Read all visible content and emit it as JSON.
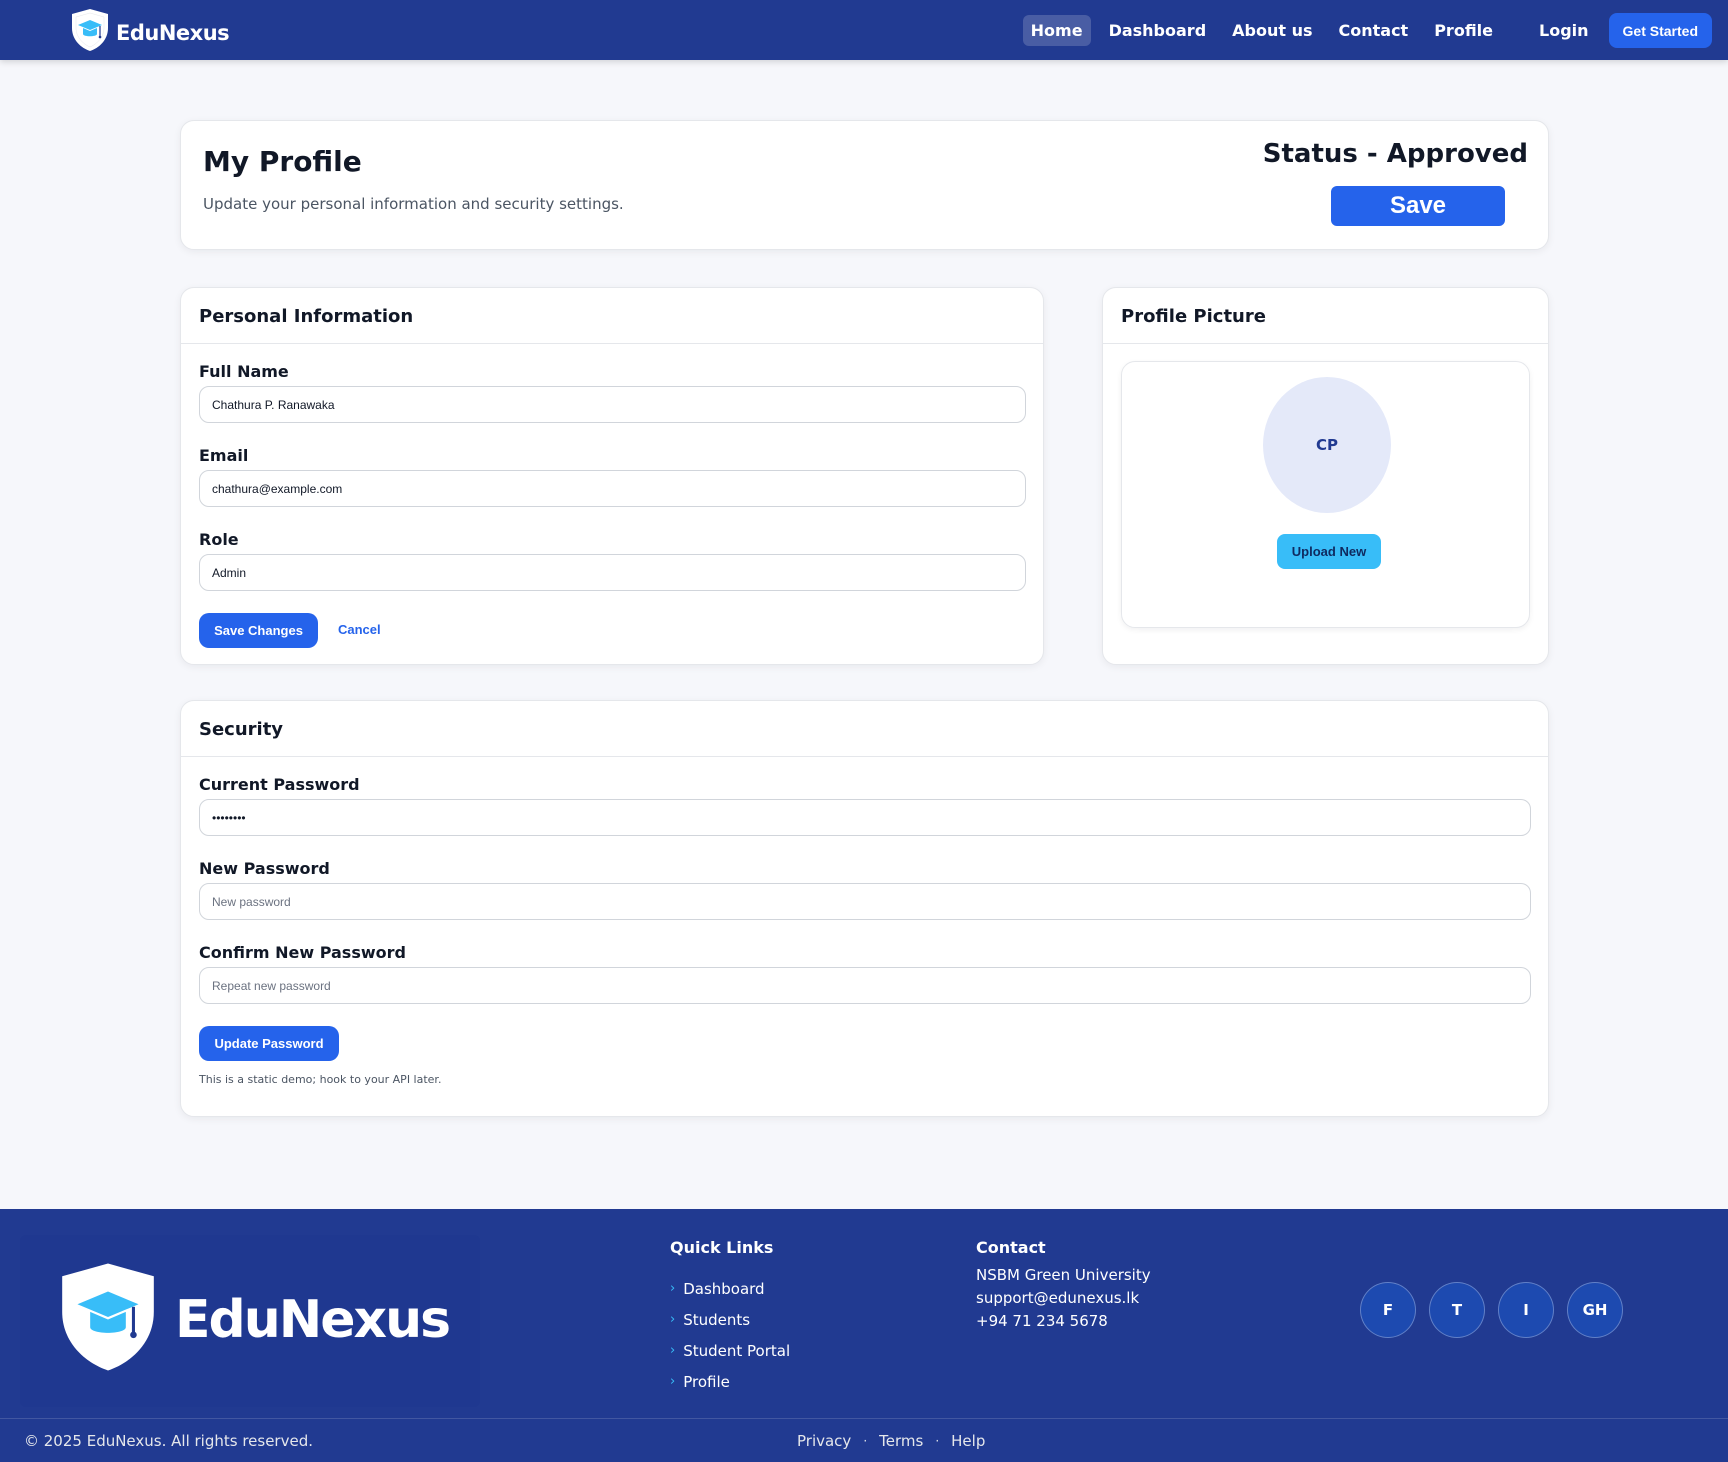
{
  "navbar": {
    "brand": "EduNexus",
    "links": [
      {
        "label": "Home",
        "active": true
      },
      {
        "label": "Dashboard"
      },
      {
        "label": "About us"
      },
      {
        "label": "Contact"
      },
      {
        "label": "Profile"
      },
      {
        "label": "Login"
      }
    ],
    "cta": "Get Started"
  },
  "page_header": {
    "title": "My Profile",
    "subtitle": "Update your personal information and security settings.",
    "status": "Status - Approved",
    "save_label": "Save"
  },
  "personal_info": {
    "title": "Personal Information",
    "fields": {
      "full_name": {
        "label": "Full Name",
        "value": "Chathura P. Ranawaka"
      },
      "email": {
        "label": "Email",
        "value": "chathura@example.com"
      },
      "role": {
        "label": "Role",
        "value": "Admin"
      }
    },
    "save_label": "Save Changes",
    "cancel_label": "Cancel"
  },
  "profile_picture": {
    "title": "Profile Picture",
    "initials": "CP",
    "upload_label": "Upload New"
  },
  "security": {
    "title": "Security",
    "fields": {
      "current_password": {
        "label": "Current Password",
        "value": "••••••••"
      },
      "new_password": {
        "label": "New Password",
        "placeholder": "New password"
      },
      "confirm_password": {
        "label": "Confirm New Password",
        "placeholder": "Repeat new password"
      }
    },
    "update_label": "Update Password",
    "hint": "This is a static demo; hook to your API later."
  },
  "footer": {
    "brand": "EduNexus",
    "quick_links_title": "Quick Links",
    "quick_links": [
      "Dashboard",
      "Students",
      "Student Portal",
      "Profile"
    ],
    "contact_title": "Contact",
    "contact_lines": [
      "NSBM Green University",
      "support@edunexus.lk",
      "+94 71 234 5678"
    ],
    "socials": [
      "F",
      "T",
      "I",
      "GH"
    ],
    "copyright": "© 2025 EduNexus. All rights reserved.",
    "legal": [
      "Privacy",
      "Terms",
      "Help"
    ]
  },
  "colors": {
    "navy": "#213a91",
    "primary": "#2563eb",
    "sky": "#38bdf8",
    "background": "#f6f7fb"
  }
}
